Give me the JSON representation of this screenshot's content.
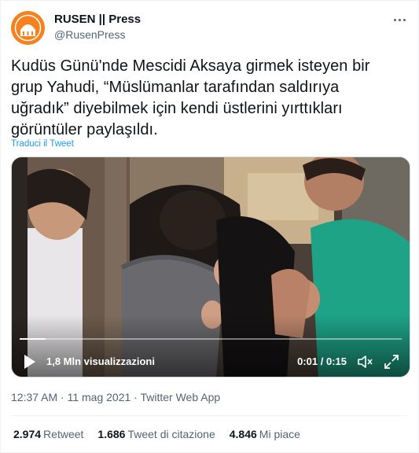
{
  "author": {
    "name": "RUSEN || Press",
    "handle": "@RusenPress"
  },
  "tweet": {
    "lines": [
      "Kudüs Günü'nde Mescidi Aksaya girmek isteyen bir",
      "grup Yahudi, “Müslümanlar tarafından saldırıya",
      "uğradık” diyebilmek için kendi üstlerini yırttıkları",
      "görüntüler paylaşıldı."
    ],
    "translate_label": "Traduci il Tweet"
  },
  "video": {
    "views": "1,8 Mln visualizzazioni",
    "time": "0:01 / 0:15",
    "progress": 0.067
  },
  "meta": {
    "timestamp": "12:37 AM · 11 mag 2021 · Twitter Web App"
  },
  "stats": {
    "retweets": {
      "count": "2.974",
      "label": "Retweet"
    },
    "quotes": {
      "count": "1.686",
      "label": "Tweet di citazione"
    },
    "likes": {
      "count": "4.846",
      "label": "Mi piace"
    }
  },
  "colors": {
    "accent": "#1d9bf0",
    "avatar": "#f5821f",
    "secondary_text": "#536471"
  },
  "icons": [
    "more-icon",
    "play-icon",
    "volume-icon",
    "fullscreen-icon"
  ]
}
